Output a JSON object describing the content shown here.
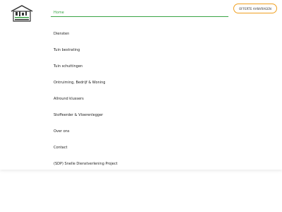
{
  "colors": {
    "accent": "#3aa546",
    "cta_border": "#f0a020"
  },
  "logo": {
    "icon": "house-with-tools-logo"
  },
  "menu": {
    "items": [
      {
        "label": "Home",
        "active": true
      },
      {
        "label": "Diensten",
        "active": false
      },
      {
        "label": "Tuin bestrating",
        "active": false
      },
      {
        "label": "Tuin schuttingen",
        "active": false
      },
      {
        "label": "Ontruiming, Bedrijf & Woning",
        "active": false
      },
      {
        "label": "Allround klussers",
        "active": false
      },
      {
        "label": "Stoffeerder & Vloerenlegger",
        "active": false
      },
      {
        "label": "Over ons",
        "active": false
      },
      {
        "label": "Contact",
        "active": false
      },
      {
        "label": "(SDP) Snelle Dienstverlening Project",
        "active": false
      }
    ]
  },
  "cta": {
    "label": "OFFERTE AANVRAGEN"
  }
}
